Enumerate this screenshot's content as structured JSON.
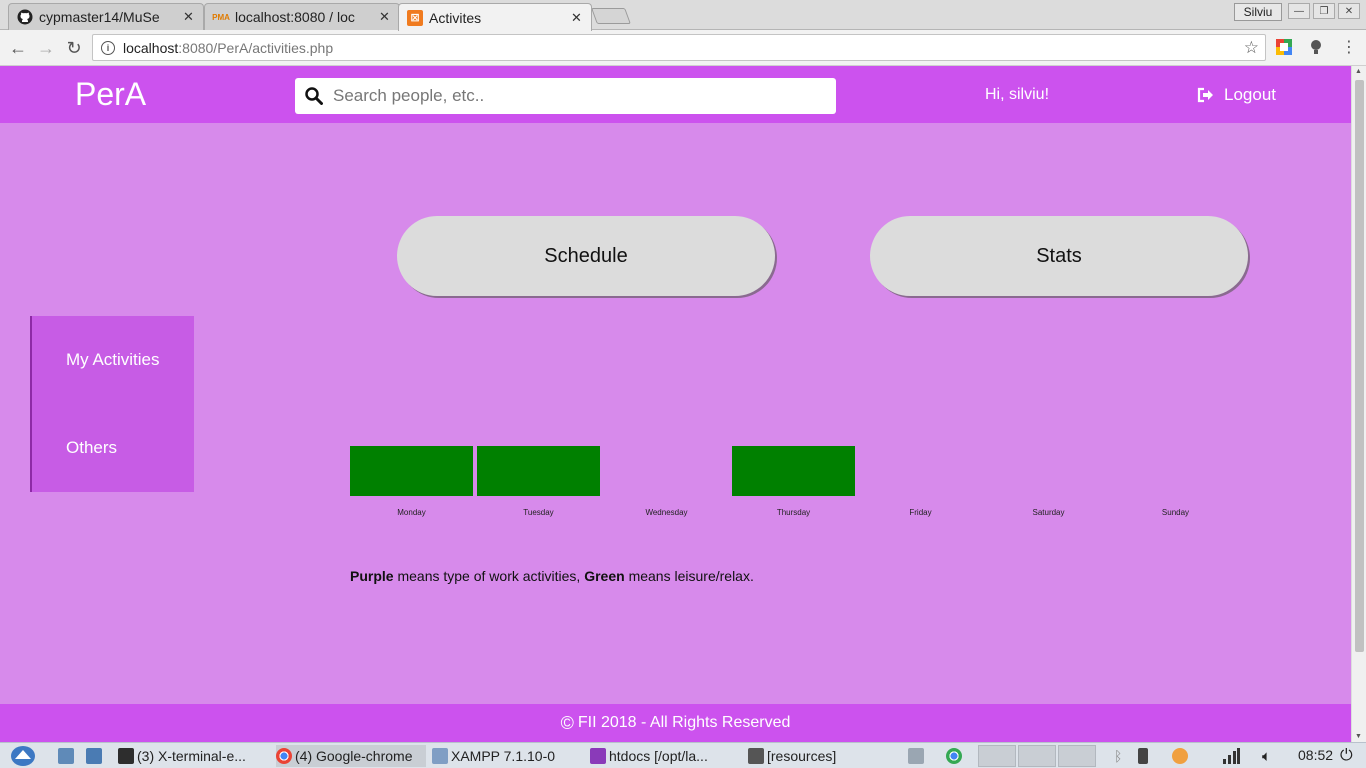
{
  "browser": {
    "tabs": [
      {
        "title": "cypmaster14/MuSe",
        "icon": "github-icon"
      },
      {
        "title": "localhost:8080 / loc",
        "icon": "phpmyadmin-icon"
      },
      {
        "title": "Activites",
        "icon": "xampp-icon",
        "active": true
      }
    ],
    "profile_name": "Silviu",
    "url_host": "localhost",
    "url_path": ":8080/PerA/activities.php"
  },
  "header": {
    "brand": "PerA",
    "search_placeholder": "Search people, etc..",
    "greeting": "Hi, silviu!",
    "logout_label": "Logout"
  },
  "main": {
    "buttons": {
      "schedule": "Schedule",
      "stats": "Stats"
    },
    "sidebar": {
      "items": [
        {
          "label": "My Activities"
        },
        {
          "label": "Others"
        }
      ]
    },
    "week": {
      "days": [
        "Monday",
        "Tuesday",
        "Wednesday",
        "Thursday",
        "Friday",
        "Saturday",
        "Sunday"
      ],
      "leisure_days": [
        "Monday",
        "Tuesday",
        "Thursday"
      ],
      "leisure_color": "#008000"
    },
    "legend": {
      "purple": "Purple",
      "purple_text": " means type of work activities, ",
      "green": "Green",
      "green_text": " means leisure/relax."
    }
  },
  "footer": {
    "text": "FII 2018 - All Rights Reserved"
  },
  "taskbar": {
    "items": [
      {
        "label": "(3) X-terminal-e..."
      },
      {
        "label": "(4) Google-chrome"
      },
      {
        "label": "XAMPP 7.1.10-0"
      },
      {
        "label": "htdocs [/opt/la..."
      },
      {
        "label": "[resources]"
      }
    ],
    "clock": "08:52"
  },
  "colors": {
    "header": "#cc52ee",
    "page_bg": "#d78aeb",
    "sidebar_bg": "#c75ce5",
    "pill_bg": "#dcdcdc"
  }
}
